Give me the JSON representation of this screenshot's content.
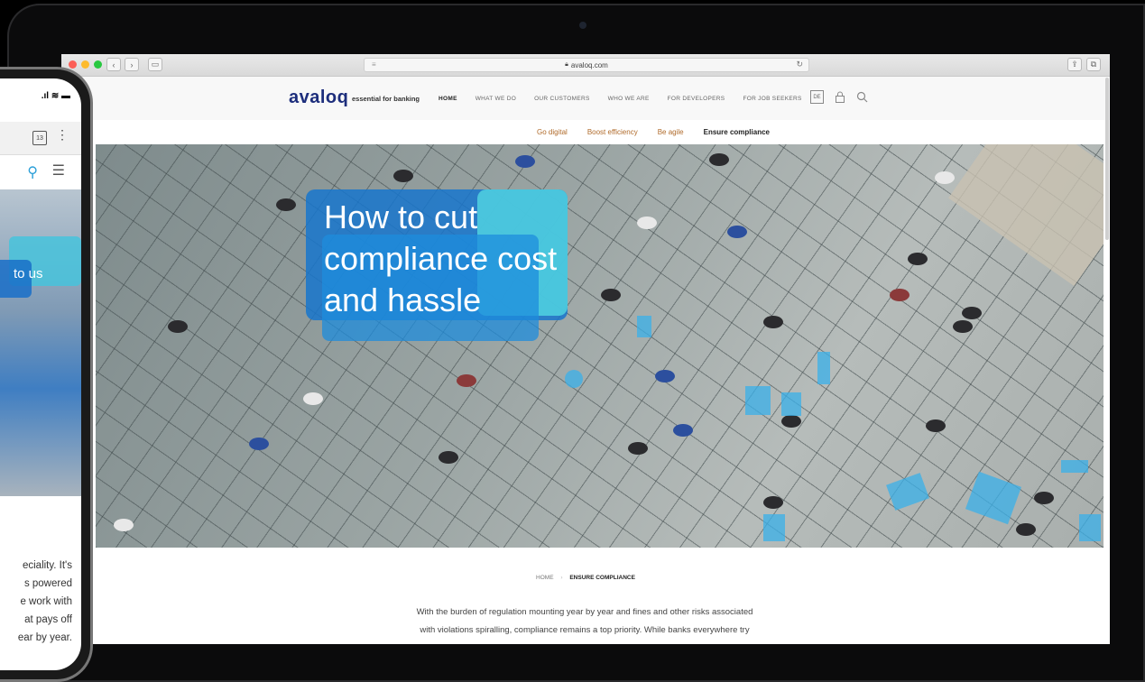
{
  "browser": {
    "url": "avaloq.com"
  },
  "site": {
    "logo": "avaloq",
    "tagline": "essential for banking",
    "nav": [
      "HOME",
      "WHAT WE DO",
      "OUR CUSTOMERS",
      "WHO WE ARE",
      "FOR DEVELOPERS",
      "FOR JOB SEEKERS"
    ],
    "lang": "DE",
    "subnav": [
      "Go digital",
      "Boost efficiency",
      "Be agile",
      "Ensure compliance"
    ],
    "hero_headline": "How to cut compliance cost and hassle",
    "breadcrumb": {
      "home": "HOME",
      "current": "ENSURE COMPLIANCE"
    },
    "intro_lines": [
      "With the burden of regulation mounting year by year and fines and other risks associated",
      "with violations spiralling, compliance remains a top priority. While banks everywhere try"
    ]
  },
  "phone": {
    "tab_count": "13",
    "hero_text": "to us",
    "body_lines": [
      "eciality. It's",
      "s powered",
      "e work with",
      "at pays off",
      "ear by year."
    ]
  },
  "colors": {
    "brand": "#1d2e7c",
    "accent": "#2b9fd8",
    "subnav_link": "#b06b2b"
  }
}
